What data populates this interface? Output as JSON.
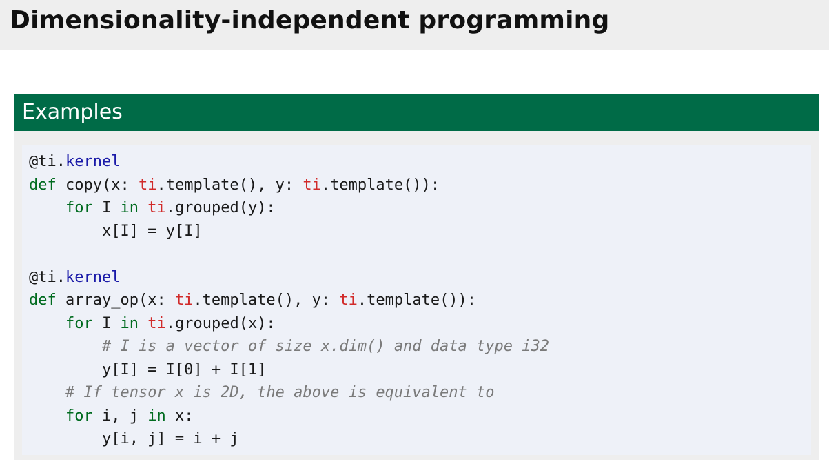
{
  "slide": {
    "title": "Dimensionality-independent programming"
  },
  "block": {
    "title": "Examples"
  },
  "code": {
    "lines": [
      [
        {
          "t": "@ti.",
          "c": "pl"
        },
        {
          "t": "kernel",
          "c": "fn"
        }
      ],
      [
        {
          "t": "def",
          "c": "kw"
        },
        {
          "t": " copy(x: ",
          "c": "pl"
        },
        {
          "t": "ti",
          "c": "ns"
        },
        {
          "t": ".template(), y: ",
          "c": "pl"
        },
        {
          "t": "ti",
          "c": "ns"
        },
        {
          "t": ".template()):",
          "c": "pl"
        }
      ],
      [
        {
          "t": "    ",
          "c": "pl"
        },
        {
          "t": "for",
          "c": "kw"
        },
        {
          "t": " I ",
          "c": "pl"
        },
        {
          "t": "in",
          "c": "kw"
        },
        {
          "t": " ",
          "c": "pl"
        },
        {
          "t": "ti",
          "c": "ns"
        },
        {
          "t": ".grouped(y):",
          "c": "pl"
        }
      ],
      [
        {
          "t": "        x[I] = y[I]",
          "c": "pl"
        }
      ],
      [],
      [
        {
          "t": "@ti.",
          "c": "pl"
        },
        {
          "t": "kernel",
          "c": "fn"
        }
      ],
      [
        {
          "t": "def",
          "c": "kw"
        },
        {
          "t": " array_op(x: ",
          "c": "pl"
        },
        {
          "t": "ti",
          "c": "ns"
        },
        {
          "t": ".template(), y: ",
          "c": "pl"
        },
        {
          "t": "ti",
          "c": "ns"
        },
        {
          "t": ".template()):",
          "c": "pl"
        }
      ],
      [
        {
          "t": "    ",
          "c": "pl"
        },
        {
          "t": "for",
          "c": "kw"
        },
        {
          "t": " I ",
          "c": "pl"
        },
        {
          "t": "in",
          "c": "kw"
        },
        {
          "t": " ",
          "c": "pl"
        },
        {
          "t": "ti",
          "c": "ns"
        },
        {
          "t": ".grouped(x):",
          "c": "pl"
        }
      ],
      [
        {
          "t": "        ",
          "c": "pl"
        },
        {
          "t": "# I is a vector of size x.dim() and data type i32",
          "c": "cm"
        }
      ],
      [
        {
          "t": "        y[I] = I[0] + I[1]",
          "c": "pl"
        }
      ],
      [
        {
          "t": "    ",
          "c": "pl"
        },
        {
          "t": "# If tensor x is 2D, the above is equivalent to",
          "c": "cm"
        }
      ],
      [
        {
          "t": "    ",
          "c": "pl"
        },
        {
          "t": "for",
          "c": "kw"
        },
        {
          "t": " i, j ",
          "c": "pl"
        },
        {
          "t": "in",
          "c": "kw"
        },
        {
          "t": " x:",
          "c": "pl"
        }
      ],
      [
        {
          "t": "        y[i, j] = i + j",
          "c": "pl"
        }
      ]
    ]
  }
}
